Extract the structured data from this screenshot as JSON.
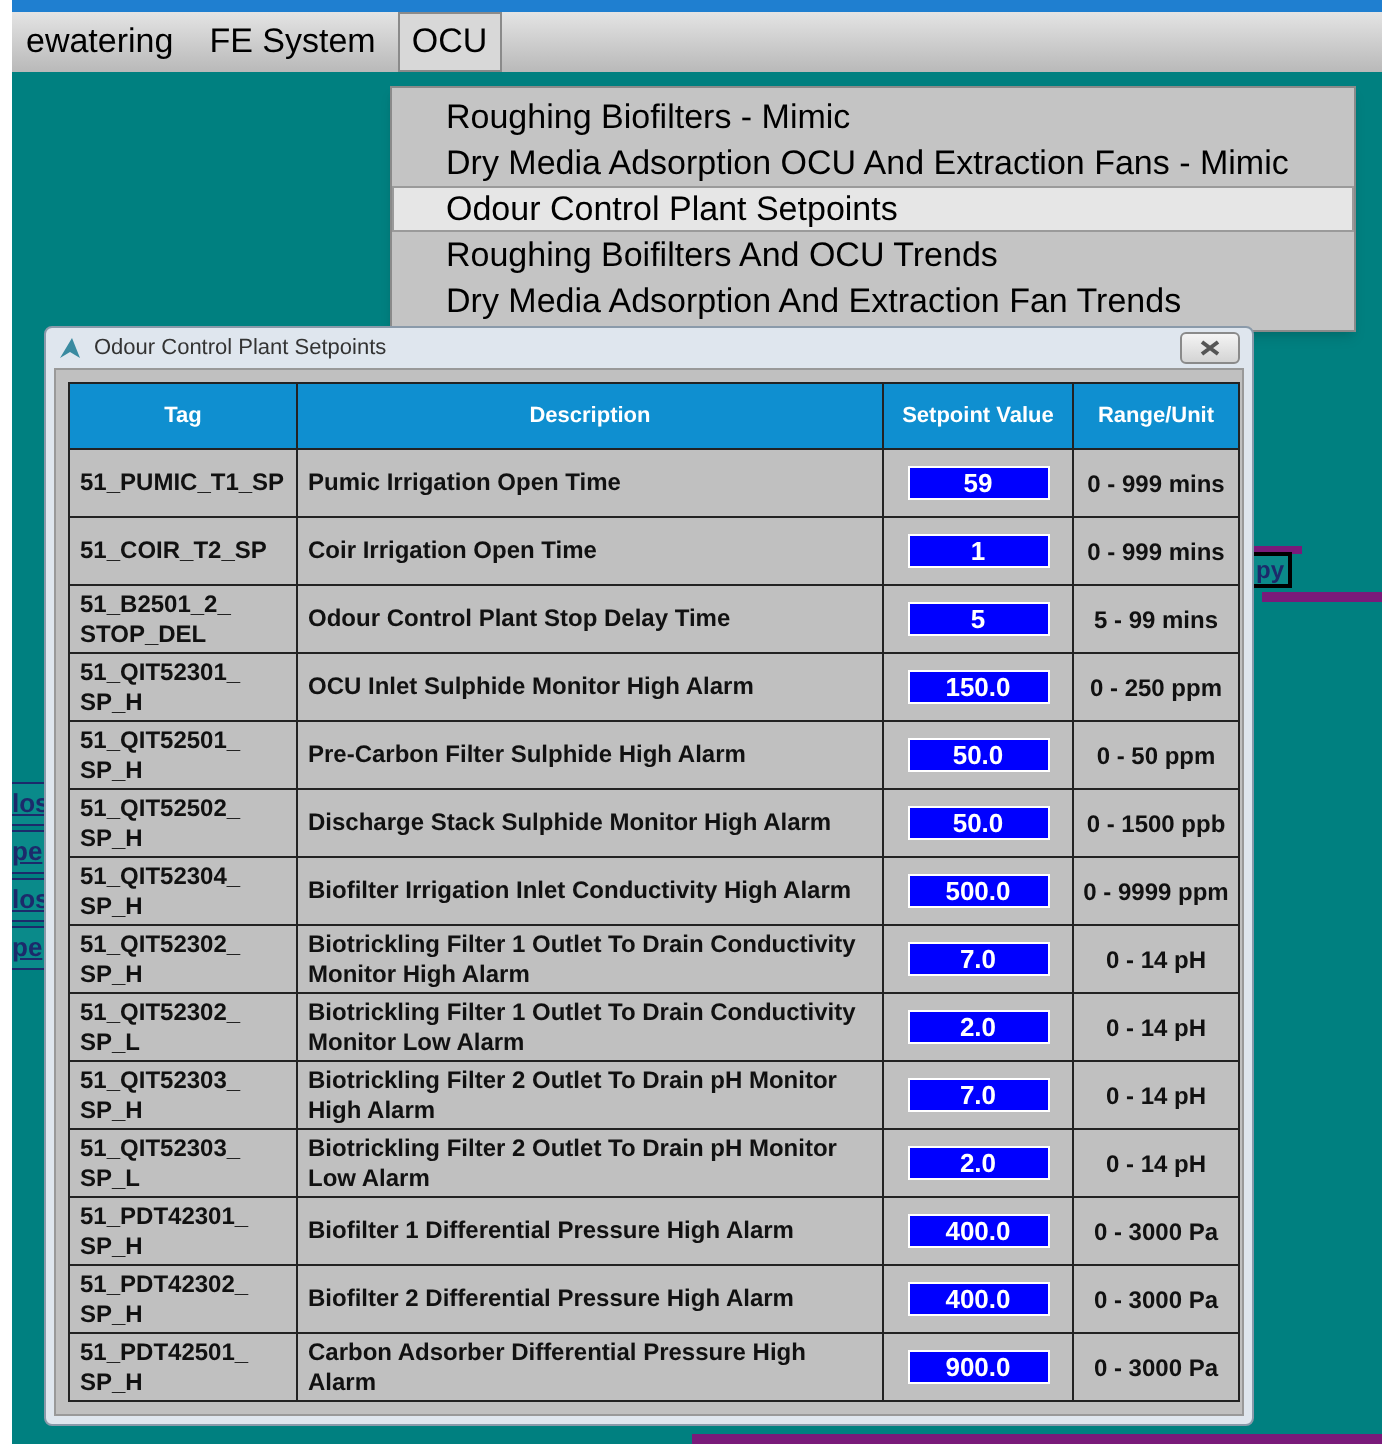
{
  "menu_bar": {
    "items": [
      {
        "label": "ewatering",
        "selected": false
      },
      {
        "label": "FE System",
        "selected": false
      },
      {
        "label": "OCU",
        "selected": true
      }
    ]
  },
  "dropdown": {
    "items": [
      {
        "label": "Roughing Biofilters - Mimic",
        "selected": false
      },
      {
        "label": "Dry Media Adsorption OCU And Extraction Fans - Mimic",
        "selected": false
      },
      {
        "label": "Odour Control Plant Setpoints",
        "selected": true
      },
      {
        "label": "Roughing Boifilters And OCU Trends",
        "selected": false
      },
      {
        "label": "Dry Media Adsorption And Extraction Fan Trends",
        "selected": false
      }
    ]
  },
  "background": {
    "left_links": [
      "los",
      "pe",
      "los",
      "pe"
    ],
    "right_button": "py"
  },
  "dialog": {
    "title": "Odour Control Plant Setpoints",
    "table": {
      "columns": [
        "Tag",
        "Description",
        "Setpoint Value",
        "Range/Unit"
      ],
      "rows": [
        {
          "tag": "51_PUMIC_T1_SP",
          "description": "Pumic Irrigation Open Time",
          "value": "59",
          "range": "0 - 999 mins"
        },
        {
          "tag": "51_COIR_T2_SP",
          "description": "Coir Irrigation Open Time",
          "value": "1",
          "range": "0 - 999 mins"
        },
        {
          "tag": "51_B2501_2_ STOP_DEL",
          "description": "Odour Control Plant Stop Delay Time",
          "value": "5",
          "range": "5 - 99 mins"
        },
        {
          "tag": "51_QIT52301_ SP_H",
          "description": "OCU Inlet Sulphide Monitor High Alarm",
          "value": "150.0",
          "range": "0 - 250 ppm"
        },
        {
          "tag": "51_QIT52501_ SP_H",
          "description": "Pre-Carbon Filter Sulphide High Alarm",
          "value": "50.0",
          "range": "0 - 50 ppm"
        },
        {
          "tag": "51_QIT52502_ SP_H",
          "description": "Discharge Stack Sulphide Monitor High Alarm",
          "value": "50.0",
          "range": "0 - 1500 ppb"
        },
        {
          "tag": "51_QIT52304_ SP_H",
          "description": "Biofilter Irrigation Inlet Conductivity High Alarm",
          "value": "500.0",
          "range": "0 - 9999 ppm"
        },
        {
          "tag": "51_QIT52302_ SP_H",
          "description": "Biotrickling Filter 1 Outlet To Drain Conductivity Monitor High Alarm",
          "value": "7.0",
          "range": "0 - 14 pH"
        },
        {
          "tag": "51_QIT52302_ SP_L",
          "description": "Biotrickling Filter 1 Outlet To Drain Conductivity Monitor Low Alarm",
          "value": "2.0",
          "range": "0 - 14 pH"
        },
        {
          "tag": "51_QIT52303_ SP_H",
          "description": "Biotrickling Filter 2 Outlet To Drain pH Monitor High Alarm",
          "value": "7.0",
          "range": "0 - 14 pH"
        },
        {
          "tag": "51_QIT52303_ SP_L",
          "description": "Biotrickling Filter 2 Outlet To Drain pH Monitor Low Alarm",
          "value": "2.0",
          "range": "0 - 14 pH"
        },
        {
          "tag": "51_PDT42301_ SP_H",
          "description": "Biofilter 1 Differential Pressure High Alarm",
          "value": "400.0",
          "range": "0 - 3000 Pa"
        },
        {
          "tag": "51_PDT42302_ SP_H",
          "description": "Biofilter 2 Differential Pressure High Alarm",
          "value": "400.0",
          "range": "0 - 3000 Pa"
        },
        {
          "tag": "51_PDT42501_ SP_H",
          "description": "Carbon Adsorber Differential Pressure High Alarm",
          "value": "900.0",
          "range": "0 - 3000 Pa"
        }
      ]
    }
  }
}
